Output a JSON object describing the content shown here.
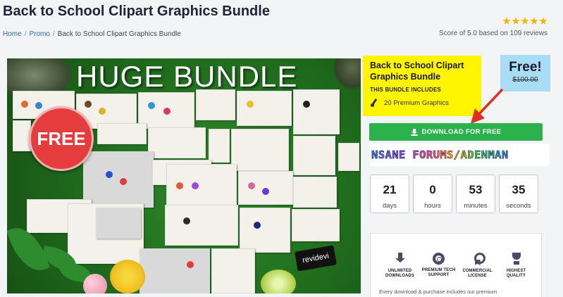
{
  "page": {
    "title": "Back to School Clipart Graphics Bundle"
  },
  "breadcrumb": {
    "home": "Home",
    "promo": "Promo",
    "current": "Back to School Clipart Graphics Bundle",
    "separator": "/"
  },
  "rating": {
    "stars": 5,
    "text": "Score of 5.0 based on 109 reviews",
    "star_color": "#f6b400"
  },
  "product_image": {
    "headline": "HUGE BUNDLE",
    "badge": "FREE",
    "brand": "revidevi"
  },
  "info": {
    "title": "Back to School Clipart Graphics Bundle",
    "includes_label": "THIS BUNDLE INCLUDES",
    "count_text": "20 Premium Graphics",
    "background": "#fff500"
  },
  "price": {
    "current": "Free!",
    "original": "$100.00",
    "background": "#a9ddf6"
  },
  "download": {
    "label": "DOWNLOAD FOR FREE",
    "color": "#2bb24c"
  },
  "watermark": {
    "text": "NSANE FORUMS/ADENMAN"
  },
  "countdown": [
    {
      "value": "21",
      "unit": "days"
    },
    {
      "value": "0",
      "unit": "hours"
    },
    {
      "value": "53",
      "unit": "minutes"
    },
    {
      "value": "35",
      "unit": "seconds"
    }
  ],
  "features": {
    "items": [
      {
        "icon": "download-icon",
        "label_line1": "UNLIMITED",
        "label_line2": "DOWNLOADS"
      },
      {
        "icon": "lifebuoy-icon",
        "label_line1": "PREMIUM TECH",
        "label_line2": "SUPPORT"
      },
      {
        "icon": "license-ribbon-icon",
        "label_line1": "COMMERCIAL",
        "label_line2": "LICENSE"
      },
      {
        "icon": "trophy-icon",
        "label_line1": "HIGHEST",
        "label_line2": "QUALITY"
      }
    ],
    "description": "Every download & purchase includes our premium"
  }
}
